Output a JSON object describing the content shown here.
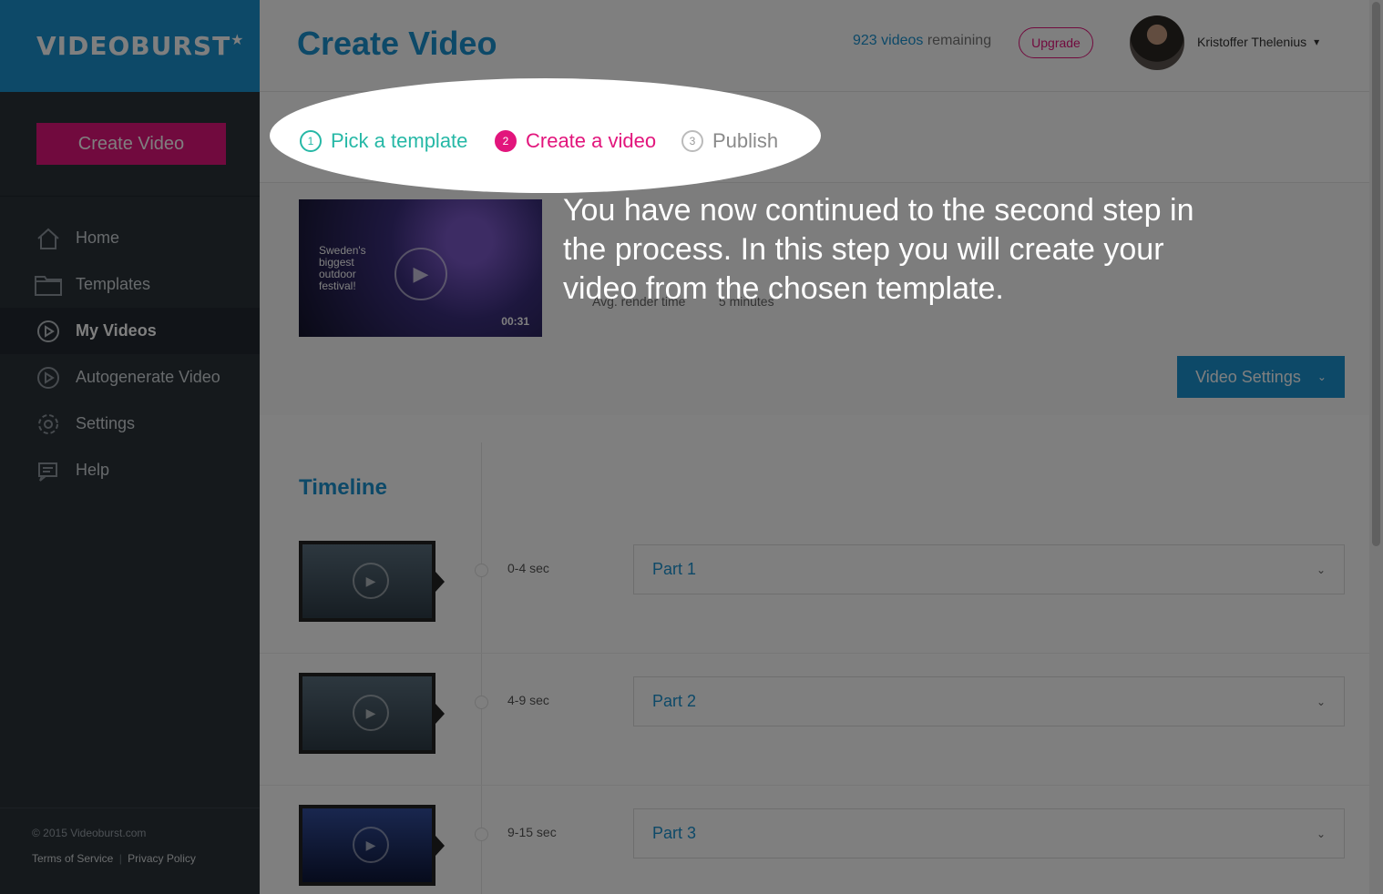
{
  "app": {
    "logo_text": "VIDEOBURST"
  },
  "sidebar": {
    "create_button": "Create Video",
    "items": [
      {
        "label": "Home",
        "icon": "home-icon"
      },
      {
        "label": "Templates",
        "icon": "folder-icon"
      },
      {
        "label": "My Videos",
        "icon": "play-circle-icon",
        "active": true
      },
      {
        "label": "Autogenerate Video",
        "icon": "play-circle-icon"
      },
      {
        "label": "Settings",
        "icon": "gear-icon"
      },
      {
        "label": "Help",
        "icon": "help-icon"
      }
    ],
    "footer": {
      "copyright": "© 2015 Videoburst.com",
      "terms": "Terms of Service",
      "separator": "|",
      "privacy": "Privacy Policy"
    }
  },
  "header": {
    "title": "Create Video",
    "remaining_count": "923 videos",
    "remaining_suffix": " remaining",
    "upgrade": "Upgrade",
    "user_name": "Kristoffer Thelenius"
  },
  "steps": [
    {
      "num": "1",
      "label": "Pick a template"
    },
    {
      "num": "2",
      "label": "Create a video"
    },
    {
      "num": "3",
      "label": "Publish"
    }
  ],
  "template": {
    "thumb_caption": "Sweden's biggest outdoor festival!",
    "duration": "00:31",
    "avg_render_label": "Avg. render time",
    "avg_render_value": "5 minutes",
    "settings_button": "Video Settings"
  },
  "timeline": {
    "title": "Timeline",
    "parts": [
      {
        "time": "0-4 sec",
        "label": "Part 1"
      },
      {
        "time": "4-9 sec",
        "label": "Part 2"
      },
      {
        "time": "9-15 sec",
        "label": "Part 3"
      }
    ]
  },
  "tour": {
    "message": "You have now continued to the second step in the process. In this step you will create your video from the chosen template."
  },
  "colors": {
    "brand_blue": "#1b92d1",
    "brand_pink": "#e2157c",
    "step_done": "#26b8a6",
    "sidebar_bg": "#2a3239"
  }
}
